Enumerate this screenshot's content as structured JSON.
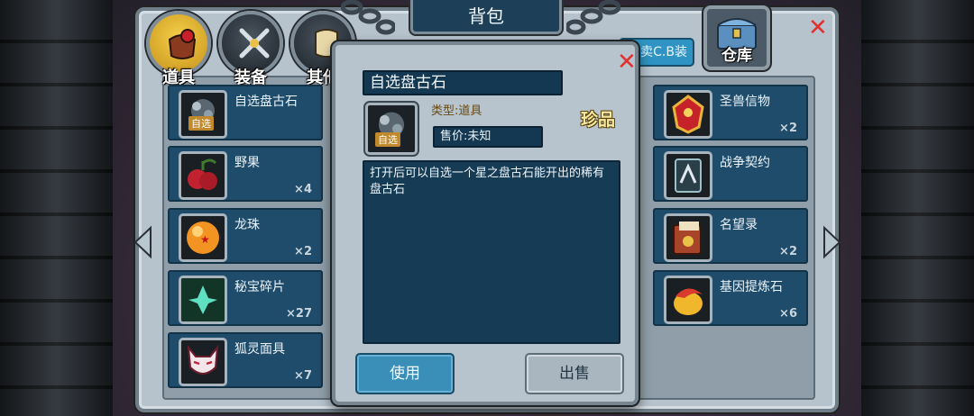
{
  "header": {
    "title": "背包"
  },
  "tabs": [
    {
      "label": "道具",
      "icon": "potion-bag-icon",
      "active": true
    },
    {
      "label": "装备",
      "icon": "crossed-swords-icon",
      "active": false
    },
    {
      "label": "其他",
      "icon": "scroll-icon",
      "active": false
    }
  ],
  "toolbar": {
    "sell_label": "卖C.B装",
    "warehouse_label": "仓库"
  },
  "left_items": [
    {
      "name": "自选盘古石",
      "qty": "",
      "tag": "自选",
      "icon": "pangu-stone-icon"
    },
    {
      "name": "野果",
      "qty": "×4",
      "icon": "wild-fruit-icon"
    },
    {
      "name": "龙珠",
      "qty": "×2",
      "icon": "dragon-ball-icon"
    },
    {
      "name": "秘宝碎片",
      "qty": "×27",
      "icon": "treasure-shard-icon"
    },
    {
      "name": "狐灵面具",
      "qty": "×7",
      "icon": "fox-mask-icon"
    }
  ],
  "right_items": [
    {
      "name": "圣兽信物",
      "qty": "×2",
      "icon": "holy-beast-token-icon"
    },
    {
      "name": "战争契约",
      "qty": "",
      "icon": "war-contract-icon"
    },
    {
      "name": "名望录",
      "qty": "×2",
      "icon": "fame-book-icon"
    },
    {
      "name": "基因提炼石",
      "qty": "×6",
      "icon": "gene-stone-icon"
    }
  ],
  "detail": {
    "name": "自选盘古石",
    "type": "类型:道具",
    "rarity": "珍品",
    "price": "售价:未知",
    "description": "打开后可以自选一个星之盘古石能开出的稀有盘古石",
    "tag": "自选",
    "use_label": "使用",
    "sell_label": "出售"
  },
  "colors": {
    "card": "#1f4c6b",
    "accent": "#2f94c3",
    "close": "#e0312f",
    "rarity": "#f6e9a1"
  }
}
